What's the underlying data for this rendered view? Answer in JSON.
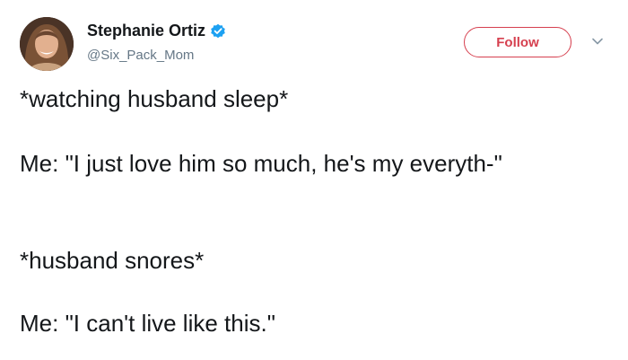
{
  "author": {
    "display_name": "Stephanie Ortiz",
    "handle": "@Six_Pack_Mom",
    "verified": true
  },
  "actions": {
    "follow_label": "Follow"
  },
  "tweet": {
    "paragraphs": [
      "*watching husband sleep*",
      "Me: \"I just love him so much, he's my everyth-\"",
      "*husband snores*",
      "Me: \"I can't live like this.\""
    ]
  },
  "colors": {
    "follow_accent": "#d6404f",
    "verified_blue": "#1da1f2",
    "handle_gray": "#657786"
  },
  "icons": {
    "verified": "verified-badge-icon",
    "caret": "chevron-down-icon"
  }
}
